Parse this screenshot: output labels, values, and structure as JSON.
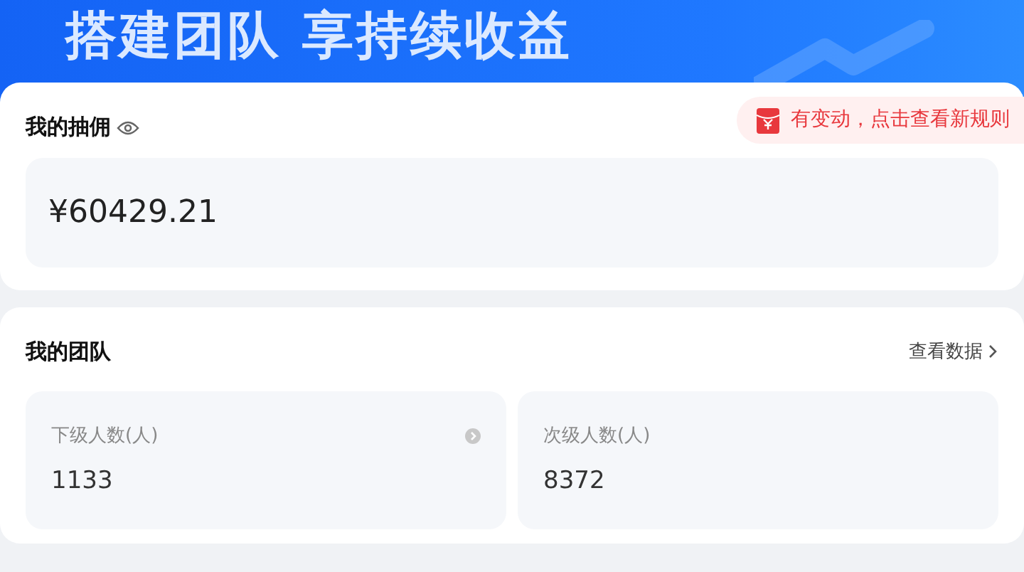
{
  "banner": {
    "title": "搭建团队 享持续收益"
  },
  "commission": {
    "title": "我的抽佣",
    "notice": "有变动，点击查看新规则",
    "amount": "¥60429.21"
  },
  "team": {
    "title": "我的团队",
    "link": "查看数据",
    "stats": [
      {
        "label": "下级人数(人)",
        "value": "1133",
        "has_arrow": true
      },
      {
        "label": "次级人数(人)",
        "value": "8372",
        "has_arrow": false
      }
    ]
  }
}
